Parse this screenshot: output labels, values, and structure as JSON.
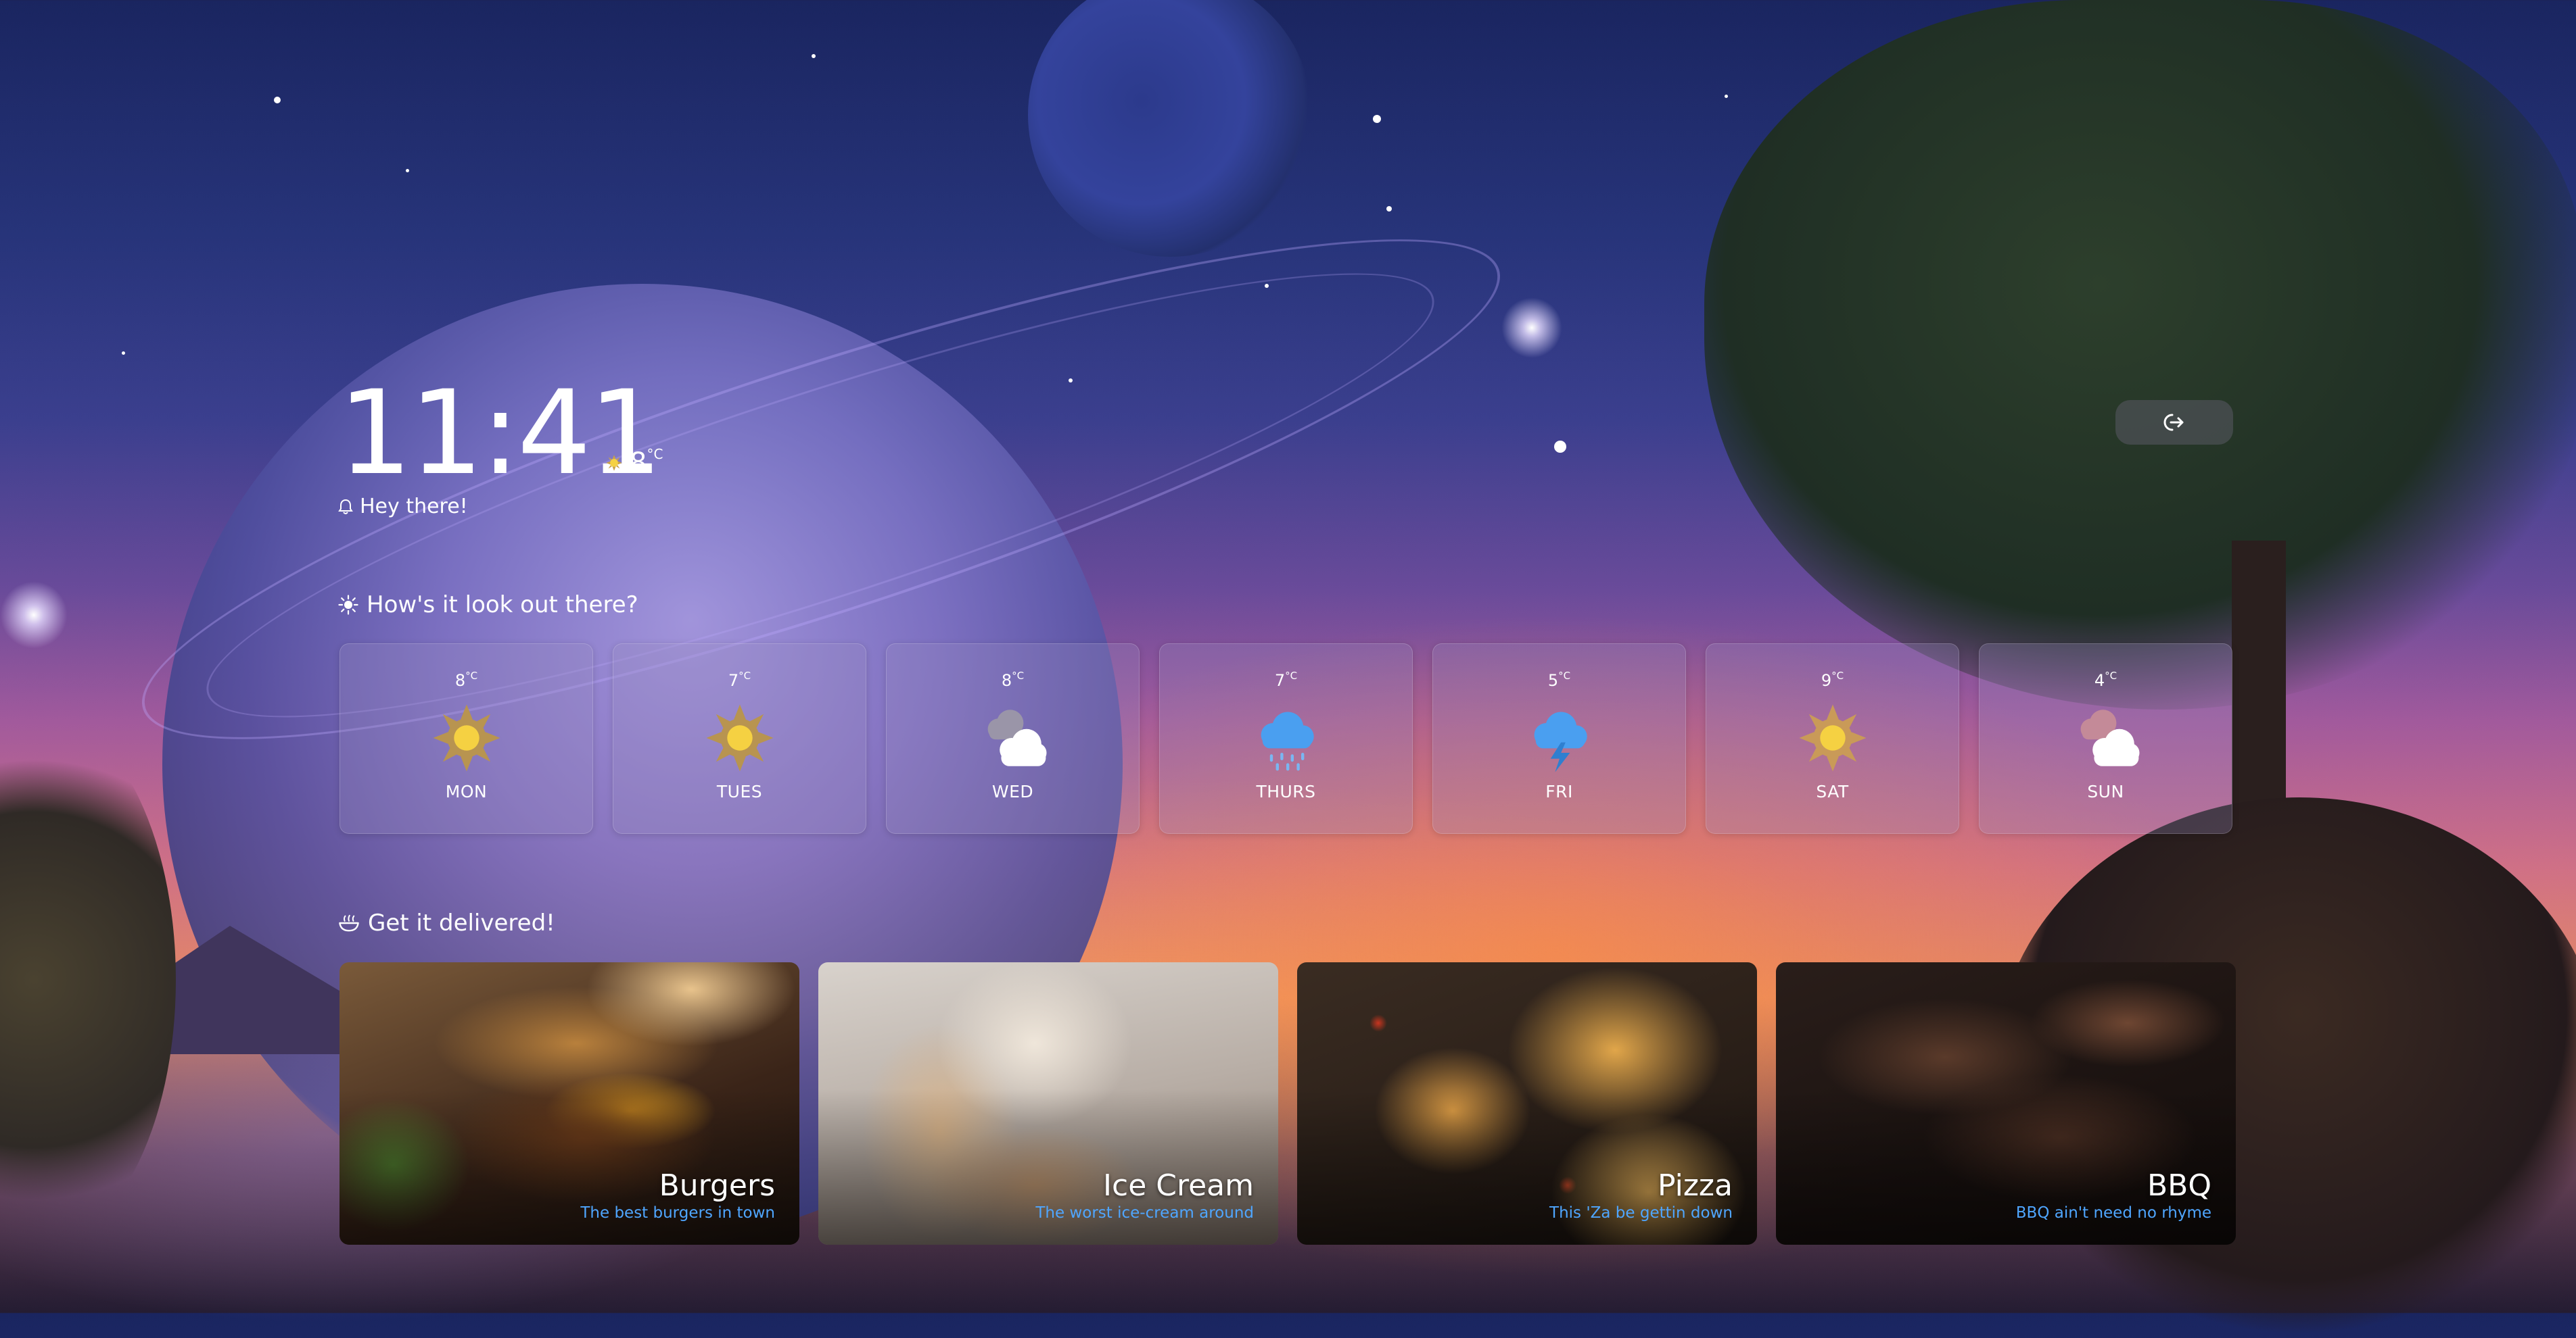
{
  "clock": {
    "time": "11:41"
  },
  "current_weather": {
    "temp": "8",
    "unit": "°C",
    "icon": "sun-icon"
  },
  "greeting": {
    "text": "Hey there!",
    "icon": "bell-icon"
  },
  "logout": {
    "icon": "logout-icon"
  },
  "forecast": {
    "title": "How's it look out there?",
    "icon": "sun-outline-icon",
    "days": [
      {
        "temp": "8",
        "unit": "°C",
        "day": "MON",
        "icon": "sunny-icon"
      },
      {
        "temp": "7",
        "unit": "°C",
        "day": "TUES",
        "icon": "sunny-icon"
      },
      {
        "temp": "8",
        "unit": "°C",
        "day": "WED",
        "icon": "cloudy-icon"
      },
      {
        "temp": "7",
        "unit": "°C",
        "day": "THURS",
        "icon": "rain-icon"
      },
      {
        "temp": "5",
        "unit": "°C",
        "day": "FRI",
        "icon": "thunderstorm-icon"
      },
      {
        "temp": "9",
        "unit": "°C",
        "day": "SAT",
        "icon": "sunny-icon"
      },
      {
        "temp": "4",
        "unit": "°C",
        "day": "SUN",
        "icon": "cloudy-icon"
      }
    ]
  },
  "delivery": {
    "title": "Get it delivered!",
    "icon": "bowl-icon",
    "items": [
      {
        "name": "Burgers",
        "tagline": "The best burgers in town"
      },
      {
        "name": "Ice Cream",
        "tagline": "The worst ice-cream around"
      },
      {
        "name": "Pizza",
        "tagline": "This 'Za be gettin down"
      },
      {
        "name": "BBQ",
        "tagline": "BBQ ain't need no rhyme"
      }
    ]
  },
  "colors": {
    "accent_link": "#4fa6ff",
    "sun": "#f5d142",
    "rain_cloud": "#4a9ff0"
  }
}
